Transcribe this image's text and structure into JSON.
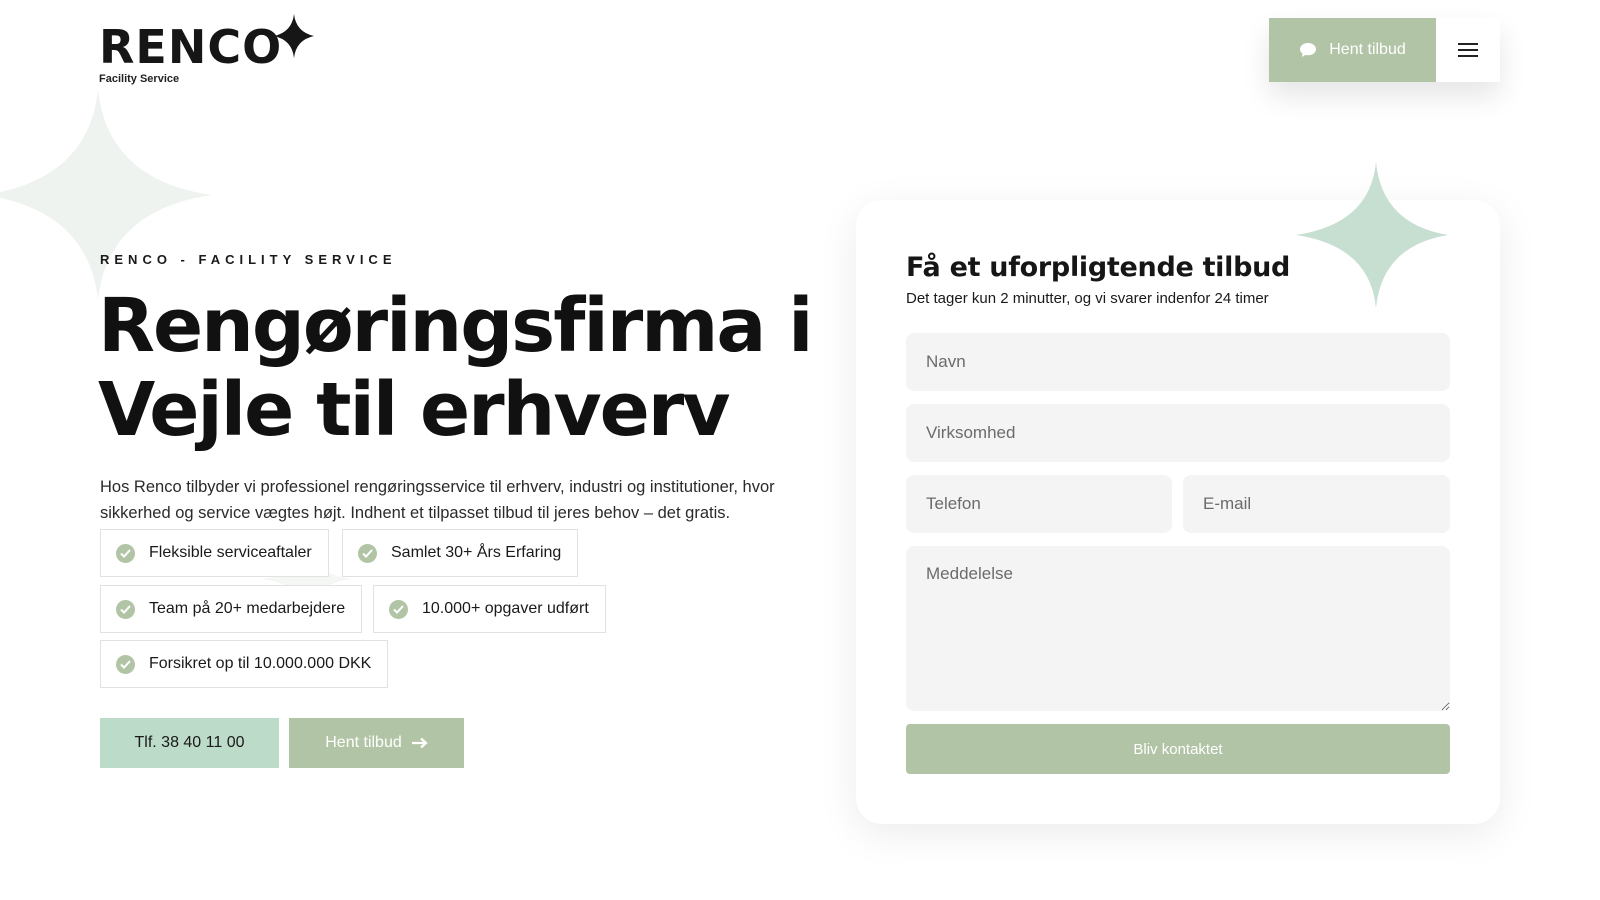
{
  "header": {
    "logo_text": "RENCO",
    "logo_subtext": "Facility Service",
    "quote_button_label": "Hent tilbud",
    "chat_icon": "chat-bubble-icon",
    "menu_icon": "hamburger-menu-icon"
  },
  "hero": {
    "eyebrow": "RENCO - FACILITY SERVICE",
    "title": "Rengøringsfirma i Vejle til erhverv",
    "description": "Hos Renco tilbyder vi professionel rengøringsservice til erhverv, industri og institutioner, hvor sikkerhed og service vægtes højt. Indhent et tilpasset tilbud til jeres behov – det gratis.",
    "features": [
      "Fleksible serviceaftaler",
      "Samlet 30+ Års Erfaring",
      "Team på 20+ medarbejdere",
      "10.000+ opgaver udført",
      "Forsikret op til 10.000.000 DKK"
    ],
    "phone_button_label": "Tlf. 38 40 11 00",
    "quote_button_label": "Hent tilbud",
    "arrow_icon": "arrow-right-icon"
  },
  "form": {
    "title": "Få et uforpligtende tilbud",
    "subtitle": "Det tager kun 2 minutter, og vi svarer indenfor 24 timer",
    "name_placeholder": "Navn",
    "company_placeholder": "Virksomhed",
    "phone_placeholder": "Telefon",
    "email_placeholder": "E-mail",
    "message_placeholder": "Meddelelse",
    "submit_label": "Bliv kontaktet"
  },
  "colors": {
    "accent_sage": "#b2c4a6",
    "accent_mint": "#bddbc9",
    "sparkle_light": "#eef3ef",
    "sparkle_mint": "#c7dfd1",
    "text_dark": "#111111",
    "field_bg": "#f4f4f4"
  }
}
